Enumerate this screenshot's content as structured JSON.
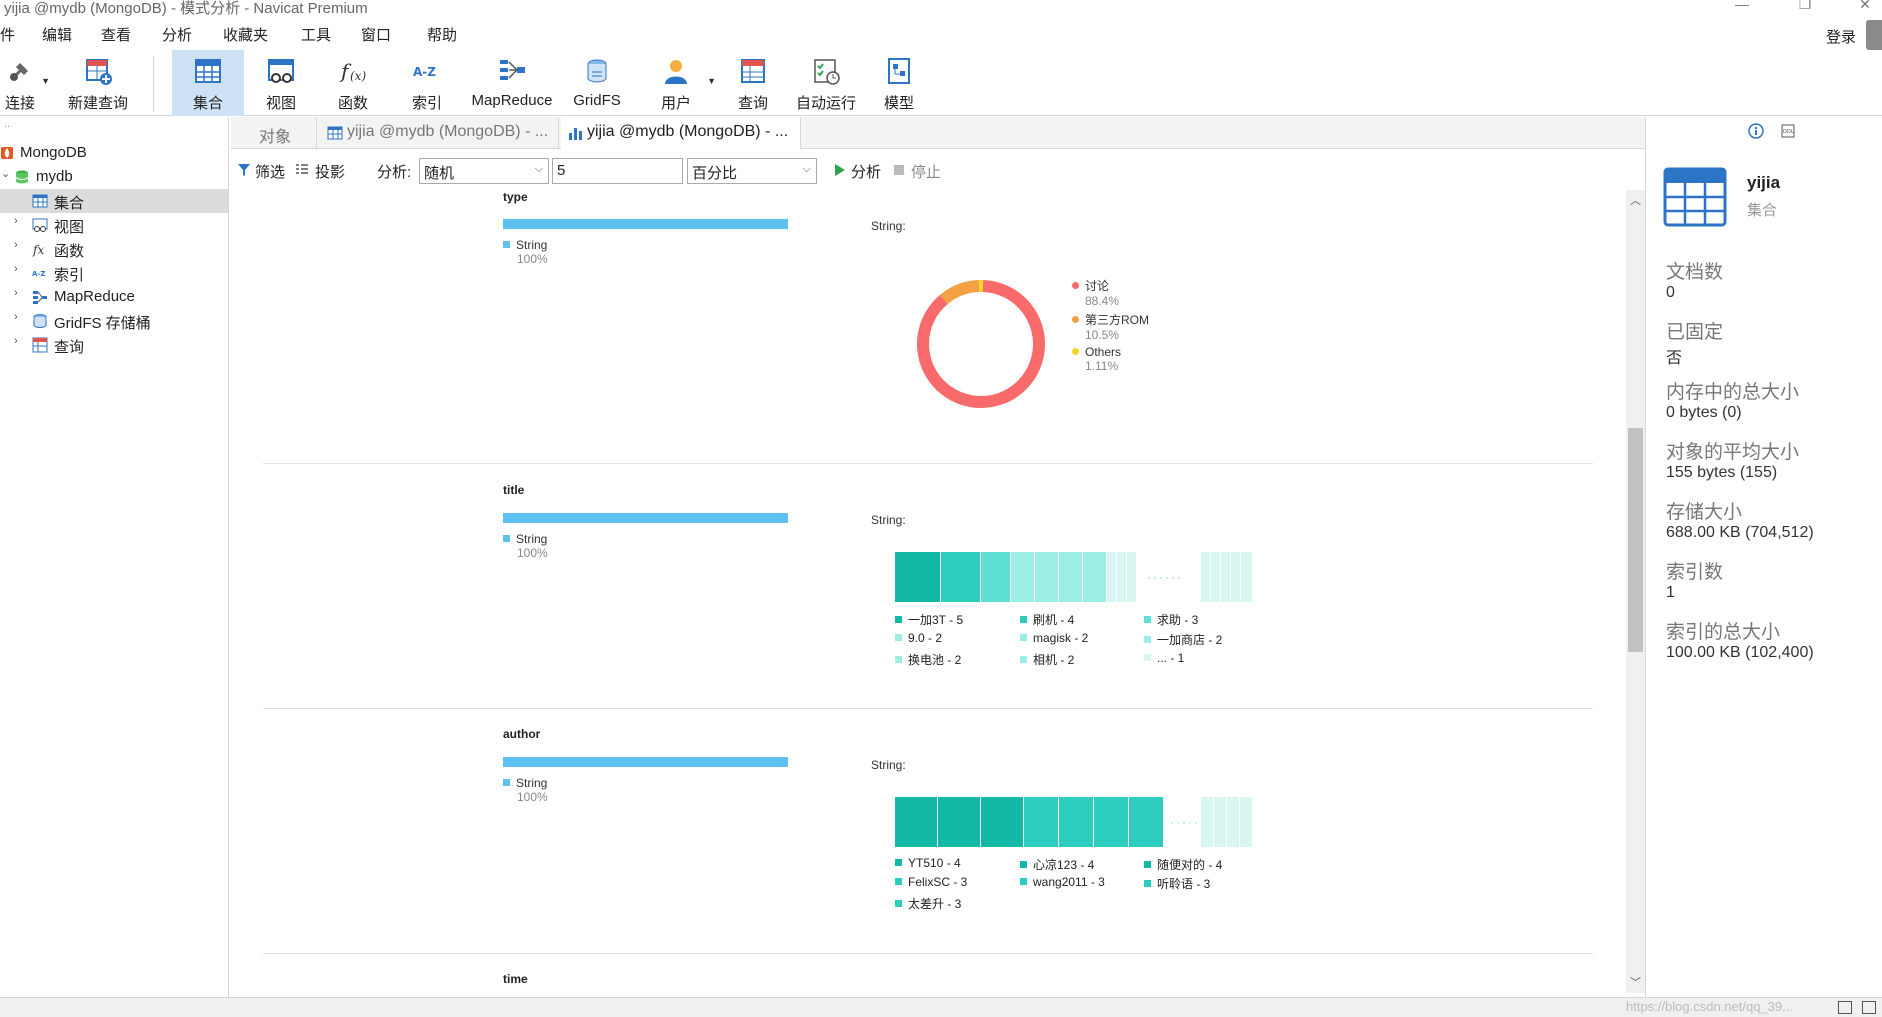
{
  "window": {
    "title": "yijia @mydb (MongoDB) - 模式分析 - Navicat Premium",
    "minimize": "—",
    "restore": "❐",
    "close": "✕"
  },
  "menu": [
    "件",
    "编辑",
    "查看",
    "分析",
    "收藏夹",
    "工具",
    "窗口",
    "帮助"
  ],
  "login_label": "登录",
  "toolbar": {
    "connect": "连接",
    "new_query": "新建查询",
    "collection": "集合",
    "view": "视图",
    "function": "函数",
    "index": "索引",
    "mapreduce": "MapReduce",
    "gridfs": "GridFS",
    "user": "用户",
    "query": "查询",
    "automation": "自动运行",
    "model": "模型",
    "active": "集合"
  },
  "nav": {
    "root": "MongoDB",
    "db": "mydb",
    "items": [
      "集合",
      "视图",
      "函数",
      "索引",
      "MapReduce",
      "GridFS 存储桶",
      "查询"
    ],
    "selected": "集合"
  },
  "tabs": [
    {
      "label": "对象"
    },
    {
      "label": "yijia @mydb (MongoDB) - ..."
    },
    {
      "label": "yijia @mydb (MongoDB) - ..."
    }
  ],
  "filterbar": {
    "filter": "筛选",
    "projection": "投影",
    "analyze_label": "分析:",
    "mode": "随机",
    "count": "5",
    "unit": "百分比",
    "run": "分析",
    "stop": "停止"
  },
  "fields": [
    {
      "name": "type",
      "type_label": "String",
      "type_pct": "100%",
      "value_label": "String:",
      "donut": [
        {
          "label": "讨论",
          "pct": "88.4%",
          "value": 88.4,
          "color": "#f96a6a"
        },
        {
          "label": "第三方ROM",
          "pct": "10.5%",
          "value": 10.5,
          "color": "#f4a146"
        },
        {
          "label": "Others",
          "pct": "1.11%",
          "value": 1.11,
          "color": "#f3d629"
        }
      ]
    },
    {
      "name": "title",
      "type_label": "String",
      "type_pct": "100%",
      "value_label": "String:",
      "legend": [
        "一加3T - 5",
        "刷机 - 4",
        "求助 - 3",
        "9.0 - 2",
        "magisk - 2",
        "一加商店 - 2",
        "换电池 - 2",
        "相机 - 2",
        "... - 1"
      ]
    },
    {
      "name": "author",
      "type_label": "String",
      "type_pct": "100%",
      "value_label": "String:",
      "legend": [
        "YT510 - 4",
        "心凉123 - 4",
        "随便对的 - 4",
        "FelixSC - 3",
        "wang2011 - 3",
        "听聆语 - 3",
        "太差升 - 3"
      ]
    },
    {
      "name": "time"
    }
  ],
  "info": {
    "name": "yijia",
    "kind": "集合",
    "props": [
      {
        "label": "文档数",
        "value": "0"
      },
      {
        "label": "已固定",
        "value": "否"
      },
      {
        "label": "内存中的总大小",
        "value": "0 bytes (0)"
      },
      {
        "label": "对象的平均大小",
        "value": "155 bytes (155)"
      },
      {
        "label": "存储大小",
        "value": "688.00 KB (704,512)"
      },
      {
        "label": "索引数",
        "value": "1"
      },
      {
        "label": "索引的总大小",
        "value": "100.00 KB (102,400)"
      }
    ]
  },
  "status": {
    "watermark": "https://blog.csdn.net/qq_39..."
  },
  "colors": {
    "accent": "#5ec1f0",
    "selected_toolbar": "#cde3f5",
    "teal_dark": "#14b8a6",
    "teal_mid": "#2ccdbf",
    "teal_light": "#9aeee6"
  }
}
